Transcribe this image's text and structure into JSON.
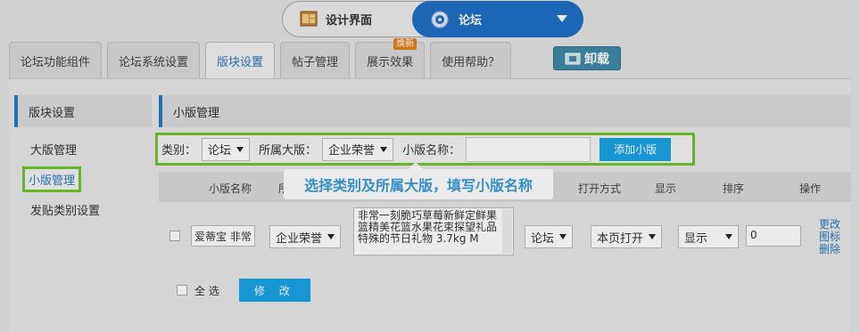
{
  "switcher": {
    "design_label": "设计界面",
    "forum_label": "论坛"
  },
  "tabs": [
    {
      "label": "论坛功能组件",
      "active": false
    },
    {
      "label": "论坛系统设置",
      "active": false
    },
    {
      "label": "版块设置",
      "active": true
    },
    {
      "label": "帖子管理",
      "active": false
    },
    {
      "label": "展示效果",
      "active": false,
      "badge": "焕新"
    },
    {
      "label": "使用帮助？",
      "active": false
    }
  ],
  "uninstall_label": "卸载",
  "sidebar": {
    "title": "版块设置",
    "items": [
      {
        "label": "大版管理",
        "active": false
      },
      {
        "label": "小版管理",
        "active": true
      },
      {
        "label": "发贴类别设置",
        "active": false
      }
    ]
  },
  "main": {
    "title": "小版管理",
    "filter": {
      "category_label": "类别：",
      "category_value": "论坛",
      "parent_label": "所属大版：",
      "parent_value": "企业荣誉",
      "name_label": "小版名称：",
      "name_value": "",
      "add_button": "添加小版"
    },
    "tooltip": "选择类别及所属大版，填写小版名称",
    "table": {
      "headers": [
        "小版名称",
        "所",
        "打开方式",
        "显示",
        "排序",
        "操作"
      ],
      "rows": [
        {
          "name": "爱蒂宝 非常",
          "parent": "企业荣誉",
          "description": "非常一刻脆巧草莓新鲜定鲜果篮精美花篮水果花束探望礼品特殊的节日礼物 3.7kg M",
          "category": "论坛",
          "open_mode": "本页打开",
          "display": "显示",
          "order": "0",
          "actions": [
            "更改",
            "图标",
            "删除"
          ]
        }
      ]
    },
    "footer": {
      "select_all": "全 选",
      "edit_button": "修 改"
    }
  },
  "colors": {
    "accent_blue": "#1aa3e6",
    "highlight_green": "#6cc629",
    "brand_blue": "#1f6fc6"
  }
}
